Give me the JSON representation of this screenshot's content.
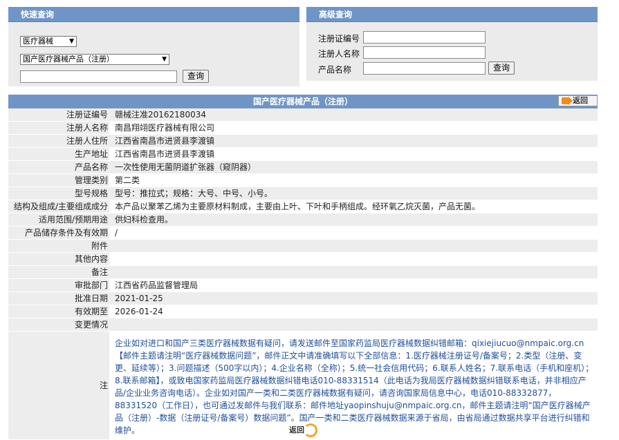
{
  "quick_search": {
    "title": "快速查询",
    "category_select": "医疗器械",
    "type_select": "国产医疗器械产品（注册）",
    "keyword_value": "",
    "query_button": "查询"
  },
  "advanced_search": {
    "title": "高级查询",
    "reg_no_label": "注册证编号",
    "registrant_label": "注册人名称",
    "product_label": "产品名称",
    "query_button": "查询"
  },
  "detail": {
    "title": "国产医疗器械产品（注册）",
    "back_label": "返回",
    "rows": [
      {
        "key": "注册证编号",
        "value": "赣械注准20162180034"
      },
      {
        "key": "注册人名称",
        "value": "南昌翔翊医疗器械有限公司"
      },
      {
        "key": "注册人住所",
        "value": "江西省南昌市进贤县李渡镇"
      },
      {
        "key": "生产地址",
        "value": "江西省南昌市进贤县李渡镇"
      },
      {
        "key": "产品名称",
        "value": "一次性使用无菌阴道扩张器（窥阴器）"
      },
      {
        "key": "管理类别",
        "value": "第二类"
      },
      {
        "key": "型号规格",
        "value": "型号：推拉式；规格：大号、中号、小号。"
      },
      {
        "key": "结构及组成/主要组成成分",
        "value": "本产品以聚苯乙烯为主要原材料制成，主要由上叶、下叶和手柄组成。经环氧乙烷灭菌，产品无菌。"
      },
      {
        "key": "适用范围/预期用途",
        "value": "供妇科检查用。"
      },
      {
        "key": "产品储存条件及有效期",
        "value": "/"
      },
      {
        "key": "附件",
        "value": ""
      },
      {
        "key": "其他内容",
        "value": ""
      },
      {
        "key": "备注",
        "value": ""
      },
      {
        "key": "审批部门",
        "value": "江西省药品监督管理局"
      },
      {
        "key": "批准日期",
        "value": "2021-01-25"
      },
      {
        "key": "有效期至",
        "value": "2026-01-24"
      },
      {
        "key": "变更情况",
        "value": ""
      }
    ],
    "note_key": "注",
    "note_text": "企业如对进口和国产三类医疗器械数据有疑问，请发送邮件至国家药监局医疗器械数据纠错邮箱：qixiejiucuo@nmpaic.org.cn【邮件主题请注明“医疗器械数据问题”，邮件正文中请准确填写以下全部信息：1.医疗器械注册证号/备案号；2.类型（注册、变更、延续等）；3.问题描述（500字以内）；4.企业名称（全称）；5.统一社会信用代码；6.联系人姓名；7.联系电话（手机和座机）；8.联系邮箱】，或致电国家药监局医疗器械数据纠错电话010-88331514（此电话为我局医疗器械数据纠错联系电话，并非相应产品/企业业务咨询电话）。企业如对国产一类和二类医疗器械数据有疑问，请咨询国家局信息中心，电话010-88332877，88331520（工作日），也可通过发邮件与我们联系：邮件地址yaopinshuju@nmpaic.org.cn，邮件主题请注明“国产医疗器械产品（注册）-数据（注册证号/备案号）数据问题”。国产一类和二类医疗器械数据来源于省局，由省局通过数据共享平台进行纠错和维护。",
    "bottom_back_label": "返回"
  }
}
